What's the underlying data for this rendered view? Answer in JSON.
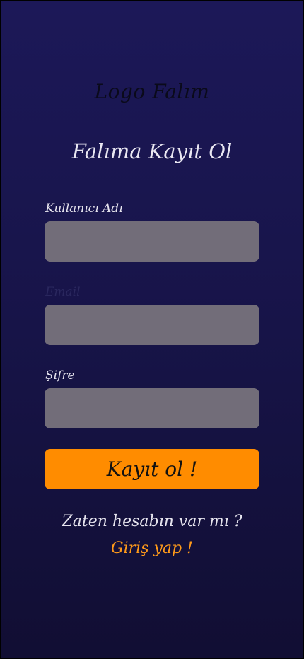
{
  "logo": {
    "text": "Logo Falım"
  },
  "page": {
    "title": "Falıma Kayıt Ol"
  },
  "form": {
    "username": {
      "label": "Kullanıcı Adı",
      "value": "",
      "placeholder": ""
    },
    "email": {
      "label": "Email",
      "value": "",
      "placeholder": ""
    },
    "password": {
      "label": "Şifre",
      "value": "",
      "placeholder": ""
    },
    "submit_label": "Kayıt ol !"
  },
  "footer": {
    "question": "Zaten hesabın var mı ?",
    "login_link": "Giriş yap !"
  },
  "colors": {
    "background_top": "#1c1858",
    "background_bottom": "#110e33",
    "field": "#726d79",
    "accent": "#ff8c00",
    "link": "#ff9a1a"
  }
}
